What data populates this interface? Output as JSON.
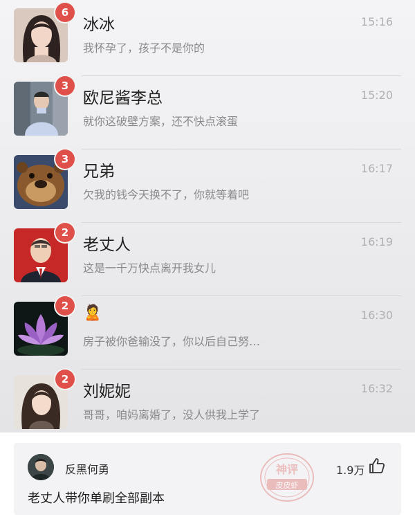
{
  "chats": [
    {
      "name": "冰冰",
      "preview": "我怀孕了，孩子不是你的",
      "time": "15:16",
      "unread": "6",
      "avatar_icon": "woman-long-hair-avatar"
    },
    {
      "name": "欧尼酱李总",
      "preview": "就你这破壁方案，还不快点滚蛋",
      "time": "15:20",
      "unread": "3",
      "avatar_icon": "man-in-car-avatar"
    },
    {
      "name": "兄弟",
      "preview": "欠我的钱今天换不了，你就等着吧",
      "time": "16:17",
      "unread": "3",
      "avatar_icon": "cartoon-bear-avatar"
    },
    {
      "name": "老丈人",
      "preview": "这是一千万快点离开我女儿",
      "time": "16:19",
      "unread": "2",
      "avatar_icon": "older-man-suit-avatar"
    },
    {
      "name": "🙎",
      "preview": "房子被你爸输没了，你以后自己努…",
      "time": "16:30",
      "unread": "2",
      "avatar_icon": "lotus-flower-avatar"
    },
    {
      "name": "刘妮妮",
      "preview": "哥哥，咱妈离婚了，没人供我上学了",
      "time": "16:32",
      "unread": "2",
      "avatar_icon": "girl-portrait-avatar"
    }
  ],
  "comment": {
    "author": "反黑何勇",
    "likes": "1.9万",
    "text": "老丈人带你单刷全部副本",
    "stamp_text_top": "神评",
    "stamp_text_bottom": "皮皮虾"
  },
  "colors": {
    "badge": "#e0504a",
    "screenshot_bg": "#ececee",
    "comment_bg": "#f3f3f5"
  }
}
